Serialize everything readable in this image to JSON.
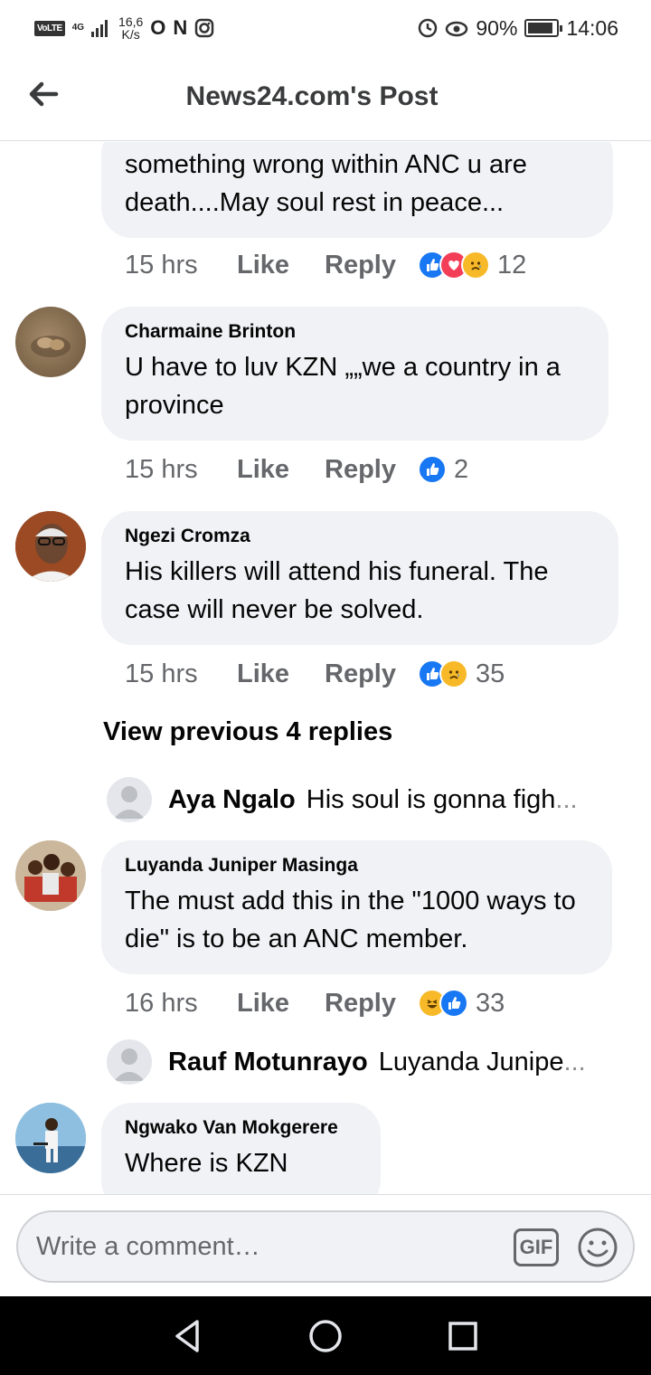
{
  "status_bar": {
    "volte": "VoLTE",
    "network": "4G",
    "speed_value": "16,6",
    "speed_unit": "K/s",
    "battery_percent": "90%",
    "battery_level": 0.9,
    "time": "14:06"
  },
  "header": {
    "title": "News24.com's Post"
  },
  "comments": [
    {
      "author": "",
      "text": "something wrong within ANC u are death....May soul rest in peace...",
      "time": "15 hrs",
      "like_label": "Like",
      "reply_label": "Reply",
      "reactions": [
        "like",
        "love",
        "sad"
      ],
      "reaction_count": "12"
    },
    {
      "author": "Charmaine Brinton",
      "text": "U have to luv KZN „„we a country in a province",
      "time": "15 hrs",
      "like_label": "Like",
      "reply_label": "Reply",
      "reactions": [
        "like"
      ],
      "reaction_count": "2"
    },
    {
      "author": "Ngezi Cromza",
      "text": "His killers will attend his funeral. The case will never be solved.",
      "time": "15 hrs",
      "like_label": "Like",
      "reply_label": "Reply",
      "reactions": [
        "like",
        "sad"
      ],
      "reaction_count": "35"
    },
    {
      "author": "Luyanda Juniper Masinga",
      "text": "The must add this in the \"1000 ways to die\" is to be an ANC member.",
      "time": "16 hrs",
      "like_label": "Like",
      "reply_label": "Reply",
      "reactions": [
        "haha",
        "like"
      ],
      "reaction_count": "33"
    },
    {
      "author": "Ngwako Van Mokgerere",
      "text": "Where is KZN"
    }
  ],
  "view_previous": "View previous 4 replies",
  "replies": [
    {
      "name": "Aya Ngalo",
      "text": "His soul is gonna figh",
      "ellipsis": "..."
    },
    {
      "name": "Rauf Motunrayo",
      "text": "Luyanda Junipe",
      "ellipsis": "..."
    }
  ],
  "composer": {
    "placeholder": "Write a comment…",
    "gif_label": "GIF"
  }
}
